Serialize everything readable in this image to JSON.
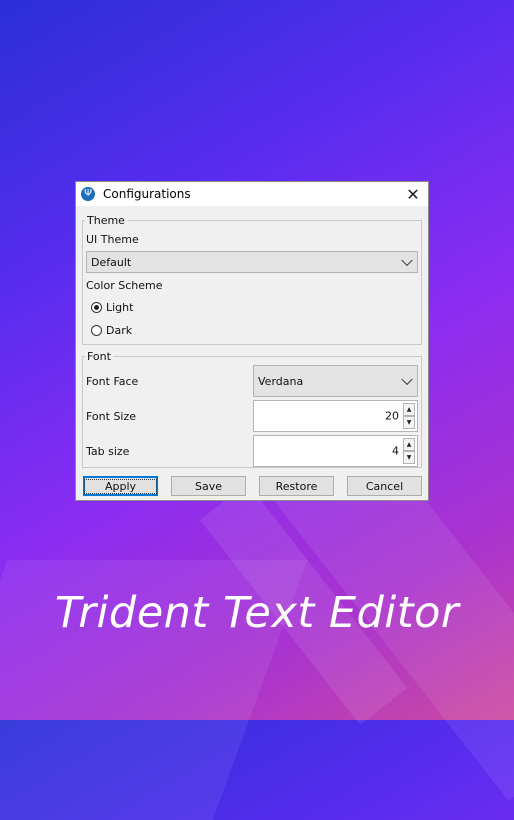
{
  "window": {
    "title": "Configurations",
    "close_glyph": "✕",
    "app_icon_glyph": "Ψ"
  },
  "theme": {
    "legend": "Theme",
    "ui_theme_label": "UI Theme",
    "ui_theme_value": "Default",
    "color_scheme_label": "Color Scheme",
    "options": [
      {
        "label": "Light",
        "checked": true
      },
      {
        "label": "Dark",
        "checked": false
      }
    ]
  },
  "font": {
    "legend": "Font",
    "face_label": "Font Face",
    "face_value": "Verdana",
    "size_label": "Font Size",
    "size_value": "20",
    "tab_label": "Tab size",
    "tab_value": "4",
    "up_glyph": "▲",
    "down_glyph": "▼"
  },
  "buttons": {
    "apply": "Apply",
    "save": "Save",
    "restore": "Restore",
    "cancel": "Cancel"
  },
  "brand": {
    "text": "Trident Text Editor"
  }
}
